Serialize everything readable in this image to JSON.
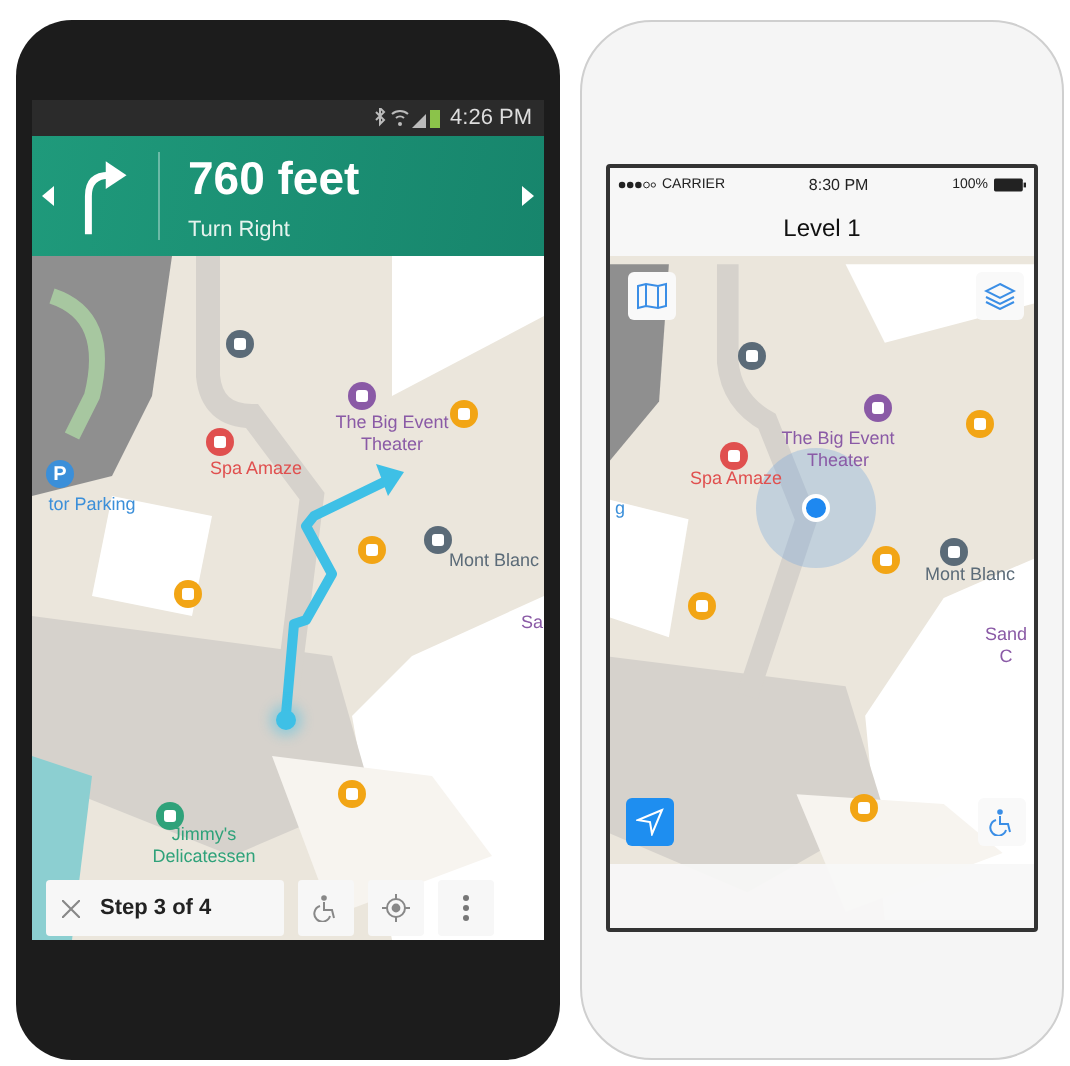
{
  "android": {
    "status_bar": {
      "time": "4:26 PM"
    },
    "navigation": {
      "distance": "760 feet",
      "instruction": "Turn Right"
    },
    "map": {
      "parking_sign": "P",
      "labels": [
        {
          "text": "The Big Event Theater",
          "color": "#8a5aa6"
        },
        {
          "text": "Spa Amaze",
          "color": "#e0504f"
        },
        {
          "text": "tor Parking",
          "color": "#3b8fd9"
        },
        {
          "text": "Mont Blanc",
          "color": "#5b6b78"
        },
        {
          "text": "Sa",
          "color": "#8a5aa6"
        },
        {
          "text": "Jimmy's Delicatessen",
          "color": "#2fa27a"
        }
      ]
    },
    "bottom_bar": {
      "step": "Step 3 of 4"
    }
  },
  "iphone": {
    "status_bar": {
      "carrier": "CARRIER",
      "time": "8:30 PM",
      "battery": "100%"
    },
    "title": "Level 1",
    "map": {
      "labels": [
        {
          "text": "The Big Event Theater",
          "color": "#8a5aa6"
        },
        {
          "text": "Spa Amaze",
          "color": "#e0504f"
        },
        {
          "text": "g",
          "color": "#3b8fd9"
        },
        {
          "text": "Mont Blanc",
          "color": "#5b6b78"
        },
        {
          "text": "Sand C",
          "color": "#8a5aa6"
        }
      ]
    }
  }
}
